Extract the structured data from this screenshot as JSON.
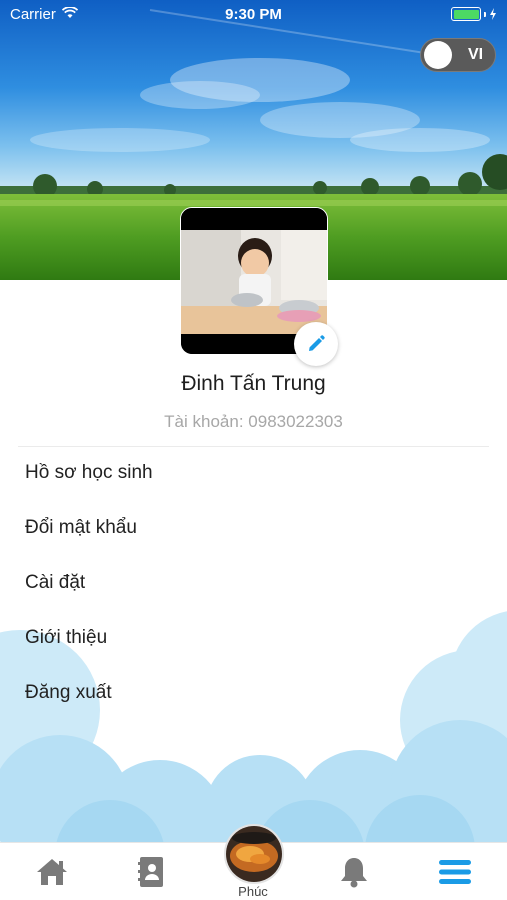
{
  "status_bar": {
    "carrier": "Carrier",
    "time": "9:30 PM"
  },
  "language_toggle": {
    "label": "VI",
    "is_on": false
  },
  "profile": {
    "name": "Đinh Tấn Trung",
    "account_label": "Tài khoản:",
    "account_value": "0983022303"
  },
  "menu": {
    "items": [
      {
        "label": "Hồ sơ học sinh"
      },
      {
        "label": "Đổi mật khẩu"
      },
      {
        "label": "Cài đặt"
      },
      {
        "label": "Giới thiệu"
      },
      {
        "label": "Đăng xuất"
      }
    ]
  },
  "tab_bar": {
    "tabs": [
      {
        "icon": "home-icon"
      },
      {
        "icon": "contact-book-icon"
      },
      {
        "icon": "child-avatar",
        "label": "Phúc"
      },
      {
        "icon": "bell-icon"
      },
      {
        "icon": "menu-icon",
        "active": true
      }
    ]
  },
  "colors": {
    "accent": "#1a9be6",
    "inactive_icon": "#7a7a7a",
    "battery": "#4cd964",
    "cloud": "#bfe4f7"
  }
}
